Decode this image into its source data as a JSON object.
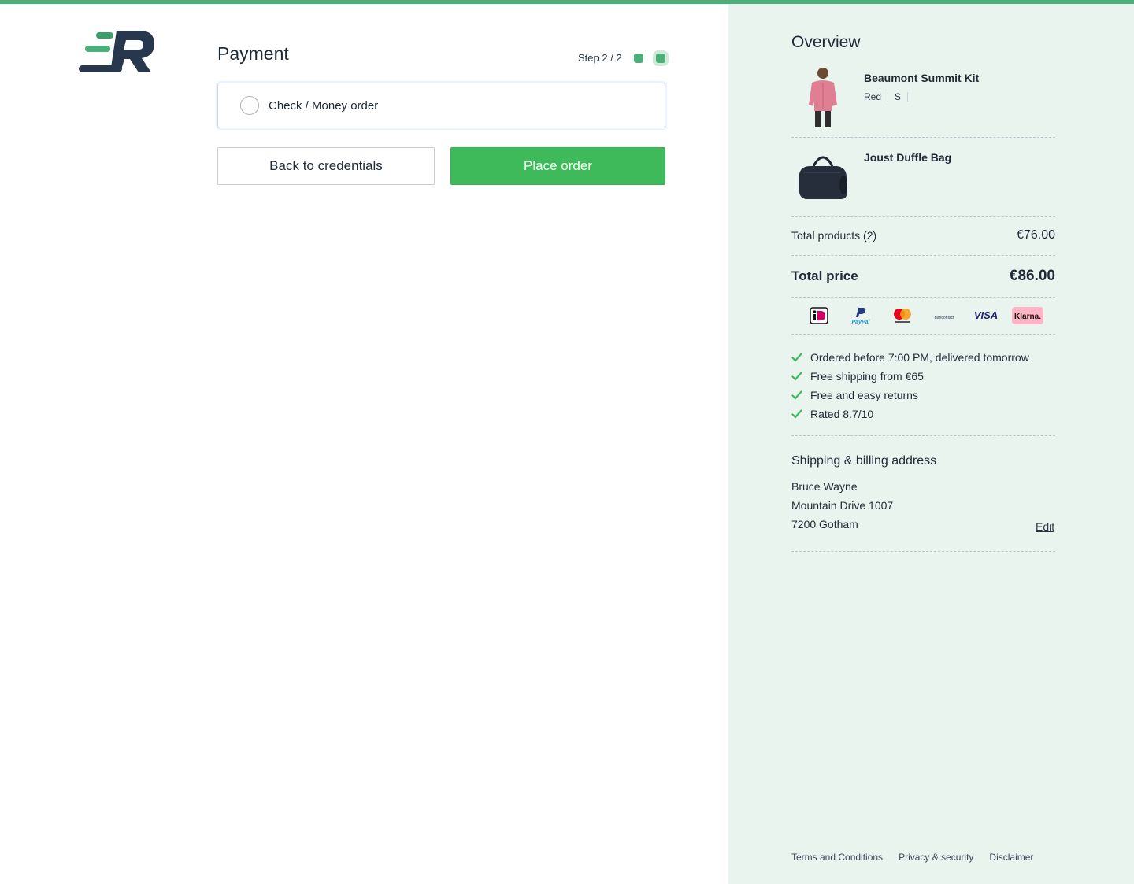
{
  "brand": {
    "logo_text": "ER",
    "accent_color": "#4caf7a",
    "button_green": "#3fba5a",
    "overview_bg": "#eaf4ee"
  },
  "payment": {
    "title": "Payment",
    "step_label": "Step 2 / 2",
    "method_label": "Check / Money order",
    "back_button": "Back to credentials",
    "place_order_button": "Place order"
  },
  "overview": {
    "title": "Overview",
    "products": [
      {
        "name": "Beaumont Summit Kit",
        "color": "Red",
        "size": "S",
        "image_icon": "jacket-man-image"
      },
      {
        "name": "Joust Duffle Bag",
        "image_icon": "duffle-bag-image"
      }
    ],
    "total_products_label": "Total products (2)",
    "total_products_value": "€76.00",
    "total_price_label": "Total price",
    "total_price_value": "€86.00",
    "payment_icons": [
      "ideal-icon",
      "paypal-icon",
      "mastercard-icon",
      "bancontact-icon",
      "visa-icon",
      "klarna-icon"
    ],
    "usps": [
      "Ordered before 7:00 PM, delivered tomorrow",
      "Free shipping from €65",
      "Free and easy returns",
      "Rated 8.7/10"
    ],
    "shipping_title": "Shipping & billing address",
    "address": {
      "name": "Bruce Wayne",
      "street": "Mountain Drive 1007",
      "city": "7200 Gotham"
    },
    "edit_label": "Edit"
  },
  "footer": {
    "links": [
      "Terms and Conditions",
      "Privacy & security",
      "Disclaimer"
    ]
  },
  "payment_icon_texts": {
    "paypal": "PayPal",
    "bancontact": "Bancontact",
    "visa": "VISA",
    "klarna": "Klarna."
  }
}
